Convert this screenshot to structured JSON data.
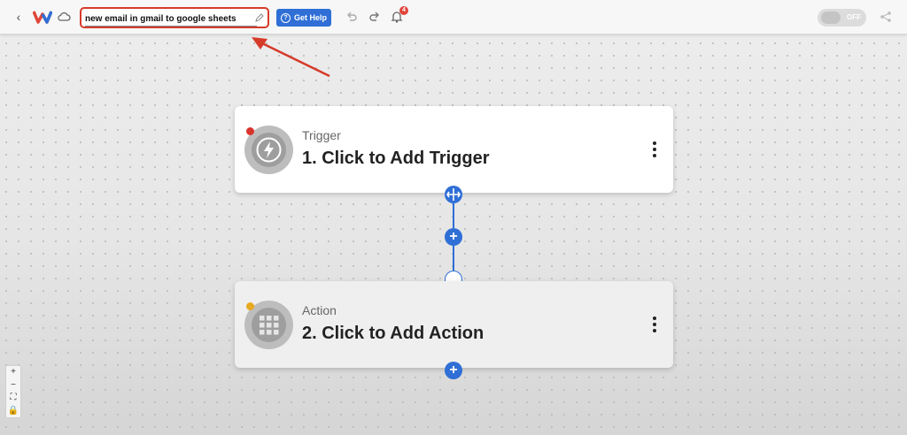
{
  "header": {
    "workflow_name": "new email in gmail to google sheets",
    "help_label": "Get Help",
    "notification_count": "4",
    "toggle_label": "OFF"
  },
  "steps": [
    {
      "subtitle": "Trigger",
      "title": "1. Click to Add Trigger",
      "status_color": "#d9342b",
      "icon": "lightning-icon"
    },
    {
      "subtitle": "Action",
      "title": "2. Click to Add Action",
      "status_color": "#e6a91f",
      "icon": "app-grid-icon"
    }
  ],
  "zoom_controls": [
    "+",
    "−",
    "⛶",
    "🔒"
  ],
  "colors": {
    "accent": "#2f6fd6",
    "highlight": "#d63b2a"
  }
}
